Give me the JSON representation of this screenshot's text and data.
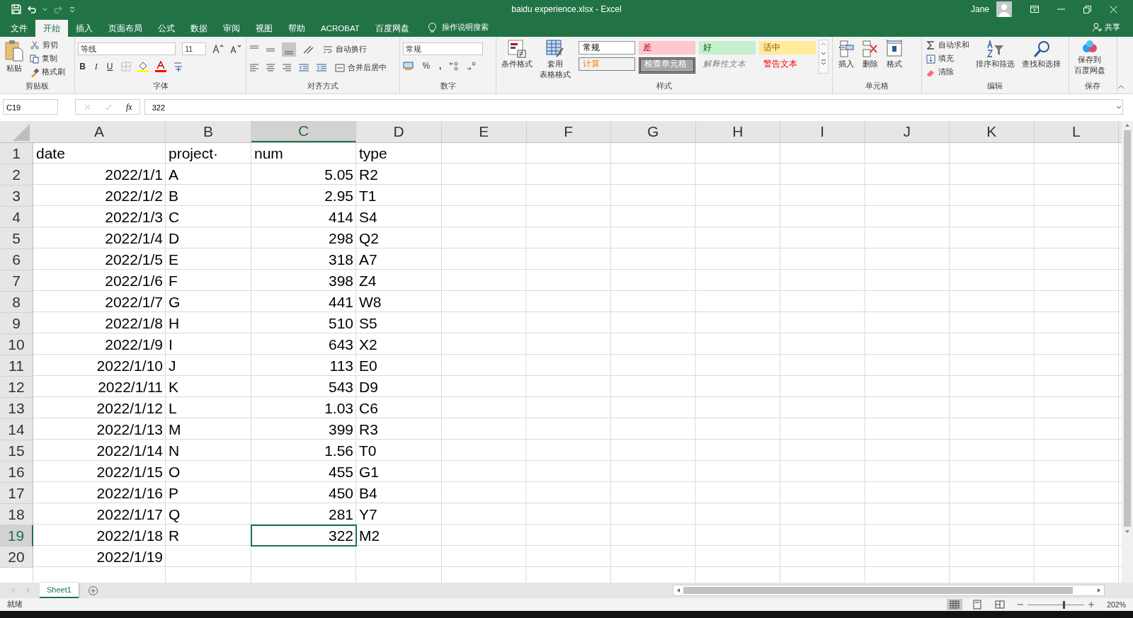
{
  "title_bar": {
    "title": "baidu experience.xlsx  -  Excel",
    "user": "Jane"
  },
  "tabs": [
    {
      "label": "文件",
      "selected": false
    },
    {
      "label": "开始",
      "selected": true
    },
    {
      "label": "插入",
      "selected": false
    },
    {
      "label": "页面布局",
      "selected": false
    },
    {
      "label": "公式",
      "selected": false
    },
    {
      "label": "数据",
      "selected": false
    },
    {
      "label": "审阅",
      "selected": false
    },
    {
      "label": "视图",
      "selected": false
    },
    {
      "label": "帮助",
      "selected": false
    },
    {
      "label": "ACROBAT",
      "selected": false
    },
    {
      "label": "百度网盘",
      "selected": false
    }
  ],
  "tell_me": "操作说明搜索",
  "share": "共享",
  "ribbon": {
    "clipboard": {
      "paste": "粘贴",
      "cut": "剪切",
      "copy": "复制",
      "format_painter": "格式刷",
      "label": "剪贴板"
    },
    "font": {
      "name": "等线",
      "size": "11",
      "bold": "B",
      "italic": "I",
      "underline": "U",
      "label": "字体"
    },
    "alignment": {
      "wrap": "自动换行",
      "merge": "合并后居中",
      "label": "对齐方式"
    },
    "number": {
      "format": "常规",
      "percent": "%",
      "comma": ",",
      "label": "数字"
    },
    "styles": {
      "conditional": "条件格式",
      "table_1": "套用",
      "table_2": "表格格式",
      "label": "样式",
      "cells": [
        {
          "text": "常规",
          "kind": "normal"
        },
        {
          "text": "差",
          "kind": "bad"
        },
        {
          "text": "好",
          "kind": "good"
        },
        {
          "text": "适中",
          "kind": "neutral"
        },
        {
          "text": "计算",
          "kind": "calculation"
        },
        {
          "text": "检查单元格",
          "kind": "check"
        },
        {
          "text": "解释性文本",
          "kind": "explanatory"
        },
        {
          "text": "警告文本",
          "kind": "warning"
        }
      ]
    },
    "cells": {
      "insert": "插入",
      "delete": "删除",
      "format": "格式",
      "label": "单元格"
    },
    "editing": {
      "autosum": "自动求和",
      "fill": "填充",
      "clear": "清除",
      "sort": "排序和筛选",
      "find": "查找和选择",
      "label": "编辑"
    },
    "save": {
      "line_1": "保存到",
      "line_2": "百度网盘",
      "label": "保存"
    }
  },
  "formula_bar": {
    "name_box": "C19",
    "fx": "fx",
    "value": "322"
  },
  "columns": [
    {
      "label": "A",
      "selected": false
    },
    {
      "label": "B",
      "selected": false
    },
    {
      "label": "C",
      "selected": true
    },
    {
      "label": "D",
      "selected": false
    },
    {
      "label": "E",
      "selected": false
    },
    {
      "label": "F",
      "selected": false
    },
    {
      "label": "G",
      "selected": false
    },
    {
      "label": "H",
      "selected": false
    },
    {
      "label": "I",
      "selected": false
    },
    {
      "label": "J",
      "selected": false
    },
    {
      "label": "K",
      "selected": false
    },
    {
      "label": "L",
      "selected": false
    }
  ],
  "rows": [
    {
      "number": "1",
      "selected": false,
      "cells": [
        {
          "v": "date",
          "kind": "text"
        },
        {
          "v": "project·",
          "kind": "text"
        },
        {
          "v": "num",
          "kind": "text"
        },
        {
          "v": "type",
          "kind": "text"
        }
      ]
    },
    {
      "number": "2",
      "selected": false,
      "cells": [
        {
          "v": "2022/1/1",
          "kind": "number"
        },
        {
          "v": "A",
          "kind": "text"
        },
        {
          "v": "5.05",
          "kind": "number"
        },
        {
          "v": "R2",
          "kind": "text"
        }
      ]
    },
    {
      "number": "3",
      "selected": false,
      "cells": [
        {
          "v": "2022/1/2",
          "kind": "number"
        },
        {
          "v": "B",
          "kind": "text"
        },
        {
          "v": "2.95",
          "kind": "number"
        },
        {
          "v": "T1",
          "kind": "text"
        }
      ]
    },
    {
      "number": "4",
      "selected": false,
      "cells": [
        {
          "v": "2022/1/3",
          "kind": "number"
        },
        {
          "v": "C",
          "kind": "text"
        },
        {
          "v": "414",
          "kind": "number"
        },
        {
          "v": "S4",
          "kind": "text"
        }
      ]
    },
    {
      "number": "5",
      "selected": false,
      "cells": [
        {
          "v": "2022/1/4",
          "kind": "number"
        },
        {
          "v": "D",
          "kind": "text"
        },
        {
          "v": "298",
          "kind": "number"
        },
        {
          "v": "Q2",
          "kind": "text"
        }
      ]
    },
    {
      "number": "6",
      "selected": false,
      "cells": [
        {
          "v": "2022/1/5",
          "kind": "number"
        },
        {
          "v": "E",
          "kind": "text"
        },
        {
          "v": "318",
          "kind": "number"
        },
        {
          "v": "A7",
          "kind": "text"
        }
      ]
    },
    {
      "number": "7",
      "selected": false,
      "cells": [
        {
          "v": "2022/1/6",
          "kind": "number"
        },
        {
          "v": "F",
          "kind": "text"
        },
        {
          "v": "398",
          "kind": "number"
        },
        {
          "v": "Z4",
          "kind": "text"
        }
      ]
    },
    {
      "number": "8",
      "selected": false,
      "cells": [
        {
          "v": "2022/1/7",
          "kind": "number"
        },
        {
          "v": "G",
          "kind": "text"
        },
        {
          "v": "441",
          "kind": "number"
        },
        {
          "v": "W8",
          "kind": "text"
        }
      ]
    },
    {
      "number": "9",
      "selected": false,
      "cells": [
        {
          "v": "2022/1/8",
          "kind": "number"
        },
        {
          "v": "H",
          "kind": "text"
        },
        {
          "v": "510",
          "kind": "number"
        },
        {
          "v": "S5",
          "kind": "text"
        }
      ]
    },
    {
      "number": "10",
      "selected": false,
      "cells": [
        {
          "v": "2022/1/9",
          "kind": "number"
        },
        {
          "v": "I",
          "kind": "text"
        },
        {
          "v": "643",
          "kind": "number"
        },
        {
          "v": "X2",
          "kind": "text"
        }
      ]
    },
    {
      "number": "11",
      "selected": false,
      "cells": [
        {
          "v": "2022/1/10",
          "kind": "number"
        },
        {
          "v": "J",
          "kind": "text"
        },
        {
          "v": "113",
          "kind": "number"
        },
        {
          "v": "E0",
          "kind": "text"
        }
      ]
    },
    {
      "number": "12",
      "selected": false,
      "cells": [
        {
          "v": "2022/1/11",
          "kind": "number"
        },
        {
          "v": "K",
          "kind": "text"
        },
        {
          "v": "543",
          "kind": "number"
        },
        {
          "v": "D9",
          "kind": "text"
        }
      ]
    },
    {
      "number": "13",
      "selected": false,
      "cells": [
        {
          "v": "2022/1/12",
          "kind": "number"
        },
        {
          "v": "L",
          "kind": "text"
        },
        {
          "v": "1.03",
          "kind": "number"
        },
        {
          "v": "C6",
          "kind": "text"
        }
      ]
    },
    {
      "number": "14",
      "selected": false,
      "cells": [
        {
          "v": "2022/1/13",
          "kind": "number"
        },
        {
          "v": "M",
          "kind": "text"
        },
        {
          "v": "399",
          "kind": "number"
        },
        {
          "v": "R3",
          "kind": "text"
        }
      ]
    },
    {
      "number": "15",
      "selected": false,
      "cells": [
        {
          "v": "2022/1/14",
          "kind": "number"
        },
        {
          "v": "N",
          "kind": "text"
        },
        {
          "v": "1.56",
          "kind": "number"
        },
        {
          "v": "T0",
          "kind": "text"
        }
      ]
    },
    {
      "number": "16",
      "selected": false,
      "cells": [
        {
          "v": "2022/1/15",
          "kind": "number"
        },
        {
          "v": "O",
          "kind": "text"
        },
        {
          "v": "455",
          "kind": "number"
        },
        {
          "v": "G1",
          "kind": "text"
        }
      ]
    },
    {
      "number": "17",
      "selected": false,
      "cells": [
        {
          "v": "2022/1/16",
          "kind": "number"
        },
        {
          "v": "P",
          "kind": "text"
        },
        {
          "v": "450",
          "kind": "number"
        },
        {
          "v": "B4",
          "kind": "text"
        }
      ]
    },
    {
      "number": "18",
      "selected": false,
      "cells": [
        {
          "v": "2022/1/17",
          "kind": "number"
        },
        {
          "v": "Q",
          "kind": "text"
        },
        {
          "v": "281",
          "kind": "number"
        },
        {
          "v": "Y7",
          "kind": "text"
        }
      ]
    },
    {
      "number": "19",
      "selected": true,
      "cells": [
        {
          "v": "2022/1/18",
          "kind": "number"
        },
        {
          "v": "R",
          "kind": "text"
        },
        {
          "v": "322",
          "kind": "number"
        },
        {
          "v": "M2",
          "kind": "text"
        }
      ]
    },
    {
      "number": "20",
      "selected": false,
      "cells": [
        {
          "v": "2022/1/19",
          "kind": "number"
        }
      ]
    }
  ],
  "sheets": [
    {
      "label": "Sheet1",
      "selected": true
    }
  ],
  "status": {
    "text": "就绪",
    "zoom": "202%",
    "zoom_slider": {
      "level": 0.62
    }
  }
}
